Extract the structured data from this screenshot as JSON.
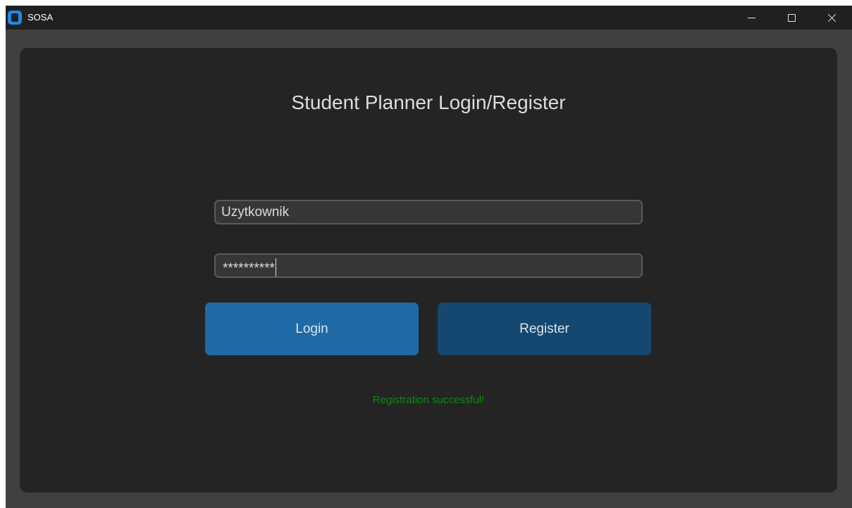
{
  "window": {
    "title": "SOSA",
    "controls": {
      "minimize": "minimize",
      "maximize": "maximize",
      "close": "close"
    }
  },
  "main": {
    "heading": "Student Planner Login/Register",
    "username": {
      "value": "Uzytkownik"
    },
    "password": {
      "value": "**********"
    },
    "login_label": "Login",
    "register_label": "Register",
    "status_message": "Registration successful!",
    "status_color": "#0f8a0f"
  },
  "colors": {
    "window_bg": "#404040",
    "panel_bg": "#242424",
    "titlebar_bg": "#202020",
    "accent": "#1f6aa5",
    "accent_dark": "#144870",
    "app_icon": "#1e8ae8"
  }
}
